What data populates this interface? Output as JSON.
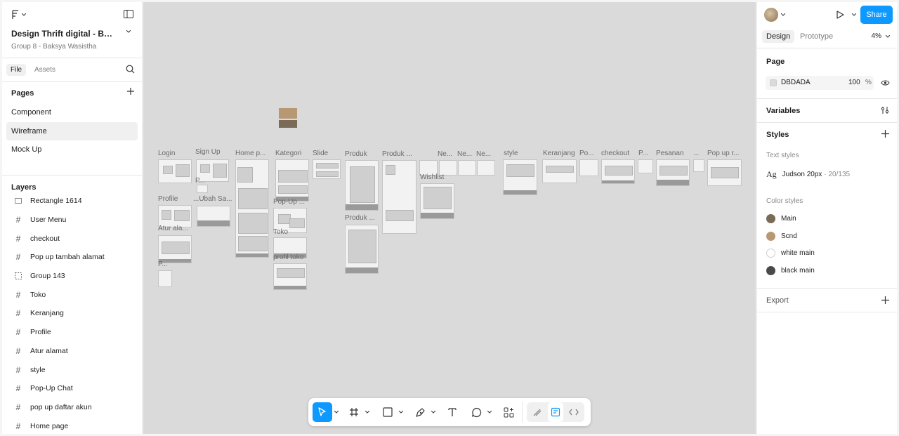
{
  "file": {
    "title": "Design Thrift digital - Baks...",
    "subtitle": "Group 8 - Baksya Wasistha"
  },
  "left_tabs": {
    "file": "File",
    "assets": "Assets"
  },
  "pages": {
    "header": "Pages",
    "items": [
      {
        "label": "Component"
      },
      {
        "label": "Wireframe"
      },
      {
        "label": "Mock Up"
      }
    ]
  },
  "layers": {
    "header": "Layers",
    "items": [
      {
        "label": "Rectangle 1614",
        "icon": "rectangle-icon"
      },
      {
        "label": "User Menu",
        "icon": "frame-icon"
      },
      {
        "label": "checkout",
        "icon": "frame-icon"
      },
      {
        "label": "Pop up tambah alamat",
        "icon": "frame-icon"
      },
      {
        "label": "Group 143",
        "icon": "group-icon"
      },
      {
        "label": "Toko",
        "icon": "frame-icon"
      },
      {
        "label": "Keranjang",
        "icon": "frame-icon"
      },
      {
        "label": "Profile",
        "icon": "frame-icon"
      },
      {
        "label": "Atur alamat",
        "icon": "frame-icon"
      },
      {
        "label": "style",
        "icon": "frame-icon"
      },
      {
        "label": "Pop-Up Chat",
        "icon": "frame-icon"
      },
      {
        "label": "pop up daftar akun",
        "icon": "frame-icon"
      },
      {
        "label": "Home page",
        "icon": "frame-icon"
      }
    ]
  },
  "canvas": {
    "background": "#DBDADA",
    "frame_labels": {
      "login": "Login",
      "signup": "Sign Up",
      "home": "Home p...",
      "kategori": "Kategori",
      "slide": "Slide",
      "produk": "Produk",
      "produk2": "Produk ...",
      "ne1": "Ne...",
      "ne2": "Ne...",
      "ne3": "Ne...",
      "style": "style",
      "keranjang": "Keranjang",
      "po": "Po...",
      "checkout": "checkout",
      "p": "P...",
      "pesanan": "Pesanan",
      "dots": "...",
      "popupr": "Pop up r...",
      "wishlist": "Wishlist",
      "profile": "Profile",
      "ubah": "...Ubah Sa...",
      "p2": "P...",
      "popup": "Pop-Up ...",
      "toko": "Toko",
      "atur": "Atur ala...",
      "produk3": "Produk ...",
      "profil_toko": "profil toko",
      "p3": "P..."
    }
  },
  "toolbar": {
    "tools": [
      "move-tool",
      "frame-tool",
      "shape-tool",
      "pen-tool",
      "text-tool",
      "comment-tool",
      "actions-tool"
    ]
  },
  "help_label": "?",
  "right": {
    "share_label": "Share",
    "tabs": {
      "design": "Design",
      "prototype": "Prototype"
    },
    "zoom": "4%",
    "page": {
      "header": "Page",
      "fill_hex": "DBDADA",
      "opacity": "100",
      "opacity_unit": "%"
    },
    "variables_header": "Variables",
    "styles": {
      "header": "Styles",
      "text_styles_header": "Text styles",
      "text_style": {
        "glyph": "Ag",
        "name": "Judson 20px",
        "meta": "· 20/135"
      },
      "color_styles_header": "Color styles",
      "colors": [
        {
          "name": "Main",
          "color": "#7a6a58"
        },
        {
          "name": "Scnd",
          "color": "#b89773"
        },
        {
          "name": "white main",
          "color": "#ffffff"
        },
        {
          "name": "black main",
          "color": "#4a4a4a"
        }
      ]
    },
    "export_header": "Export"
  }
}
